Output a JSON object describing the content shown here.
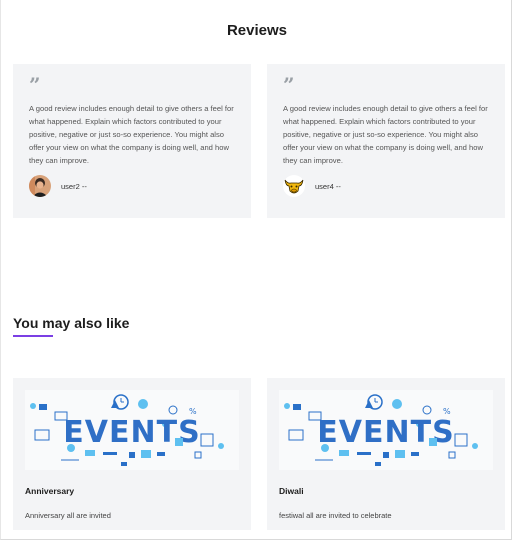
{
  "reviews": {
    "title": "Reviews",
    "quote_icon": "quote-icon",
    "items": [
      {
        "text": "A good review includes enough detail to give others a feel for what happened. Explain which factors contributed to your positive, negative or just so-so experience. You might also offer your view on what the company is doing well, and how they can improve.",
        "user": "user2 --",
        "avatar": "person-photo-avatar"
      },
      {
        "text": "A good review includes enough detail to give others a feel for what happened. Explain which factors contributed to your positive, negative or just so-so experience. You might also offer your view on what the company is doing well, and how they can improve.",
        "user": "user4 --",
        "avatar": "bull-logo-avatar"
      }
    ]
  },
  "also_like": {
    "title": "You may also like",
    "accent_color": "#7b3fe4",
    "items": [
      {
        "image_text": "EVENTS",
        "title": "Anniversary",
        "description": "Anniversary all are invited"
      },
      {
        "image_text": "EVENTS",
        "title": "Diwali",
        "description": "festiwal all are invited to celebrate"
      }
    ]
  }
}
